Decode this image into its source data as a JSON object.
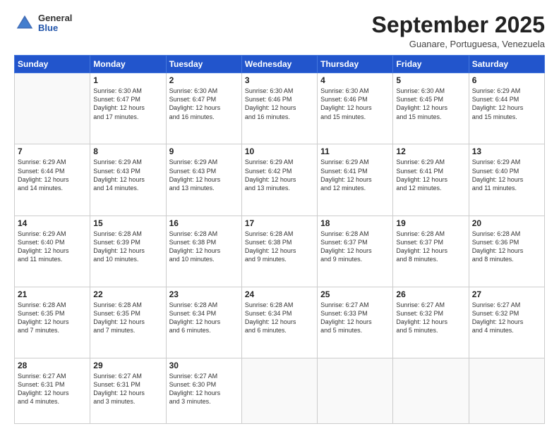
{
  "header": {
    "logo": {
      "line1": "General",
      "line2": "Blue"
    },
    "title": "September 2025",
    "subtitle": "Guanare, Portuguesa, Venezuela"
  },
  "weekdays": [
    "Sunday",
    "Monday",
    "Tuesday",
    "Wednesday",
    "Thursday",
    "Friday",
    "Saturday"
  ],
  "weeks": [
    [
      {
        "day": "",
        "info": ""
      },
      {
        "day": "1",
        "info": "Sunrise: 6:30 AM\nSunset: 6:47 PM\nDaylight: 12 hours\nand 17 minutes."
      },
      {
        "day": "2",
        "info": "Sunrise: 6:30 AM\nSunset: 6:47 PM\nDaylight: 12 hours\nand 16 minutes."
      },
      {
        "day": "3",
        "info": "Sunrise: 6:30 AM\nSunset: 6:46 PM\nDaylight: 12 hours\nand 16 minutes."
      },
      {
        "day": "4",
        "info": "Sunrise: 6:30 AM\nSunset: 6:46 PM\nDaylight: 12 hours\nand 15 minutes."
      },
      {
        "day": "5",
        "info": "Sunrise: 6:30 AM\nSunset: 6:45 PM\nDaylight: 12 hours\nand 15 minutes."
      },
      {
        "day": "6",
        "info": "Sunrise: 6:29 AM\nSunset: 6:44 PM\nDaylight: 12 hours\nand 15 minutes."
      }
    ],
    [
      {
        "day": "7",
        "info": "Sunrise: 6:29 AM\nSunset: 6:44 PM\nDaylight: 12 hours\nand 14 minutes."
      },
      {
        "day": "8",
        "info": "Sunrise: 6:29 AM\nSunset: 6:43 PM\nDaylight: 12 hours\nand 14 minutes."
      },
      {
        "day": "9",
        "info": "Sunrise: 6:29 AM\nSunset: 6:43 PM\nDaylight: 12 hours\nand 13 minutes."
      },
      {
        "day": "10",
        "info": "Sunrise: 6:29 AM\nSunset: 6:42 PM\nDaylight: 12 hours\nand 13 minutes."
      },
      {
        "day": "11",
        "info": "Sunrise: 6:29 AM\nSunset: 6:41 PM\nDaylight: 12 hours\nand 12 minutes."
      },
      {
        "day": "12",
        "info": "Sunrise: 6:29 AM\nSunset: 6:41 PM\nDaylight: 12 hours\nand 12 minutes."
      },
      {
        "day": "13",
        "info": "Sunrise: 6:29 AM\nSunset: 6:40 PM\nDaylight: 12 hours\nand 11 minutes."
      }
    ],
    [
      {
        "day": "14",
        "info": "Sunrise: 6:29 AM\nSunset: 6:40 PM\nDaylight: 12 hours\nand 11 minutes."
      },
      {
        "day": "15",
        "info": "Sunrise: 6:28 AM\nSunset: 6:39 PM\nDaylight: 12 hours\nand 10 minutes."
      },
      {
        "day": "16",
        "info": "Sunrise: 6:28 AM\nSunset: 6:38 PM\nDaylight: 12 hours\nand 10 minutes."
      },
      {
        "day": "17",
        "info": "Sunrise: 6:28 AM\nSunset: 6:38 PM\nDaylight: 12 hours\nand 9 minutes."
      },
      {
        "day": "18",
        "info": "Sunrise: 6:28 AM\nSunset: 6:37 PM\nDaylight: 12 hours\nand 9 minutes."
      },
      {
        "day": "19",
        "info": "Sunrise: 6:28 AM\nSunset: 6:37 PM\nDaylight: 12 hours\nand 8 minutes."
      },
      {
        "day": "20",
        "info": "Sunrise: 6:28 AM\nSunset: 6:36 PM\nDaylight: 12 hours\nand 8 minutes."
      }
    ],
    [
      {
        "day": "21",
        "info": "Sunrise: 6:28 AM\nSunset: 6:35 PM\nDaylight: 12 hours\nand 7 minutes."
      },
      {
        "day": "22",
        "info": "Sunrise: 6:28 AM\nSunset: 6:35 PM\nDaylight: 12 hours\nand 7 minutes."
      },
      {
        "day": "23",
        "info": "Sunrise: 6:28 AM\nSunset: 6:34 PM\nDaylight: 12 hours\nand 6 minutes."
      },
      {
        "day": "24",
        "info": "Sunrise: 6:28 AM\nSunset: 6:34 PM\nDaylight: 12 hours\nand 6 minutes."
      },
      {
        "day": "25",
        "info": "Sunrise: 6:27 AM\nSunset: 6:33 PM\nDaylight: 12 hours\nand 5 minutes."
      },
      {
        "day": "26",
        "info": "Sunrise: 6:27 AM\nSunset: 6:32 PM\nDaylight: 12 hours\nand 5 minutes."
      },
      {
        "day": "27",
        "info": "Sunrise: 6:27 AM\nSunset: 6:32 PM\nDaylight: 12 hours\nand 4 minutes."
      }
    ],
    [
      {
        "day": "28",
        "info": "Sunrise: 6:27 AM\nSunset: 6:31 PM\nDaylight: 12 hours\nand 4 minutes."
      },
      {
        "day": "29",
        "info": "Sunrise: 6:27 AM\nSunset: 6:31 PM\nDaylight: 12 hours\nand 3 minutes."
      },
      {
        "day": "30",
        "info": "Sunrise: 6:27 AM\nSunset: 6:30 PM\nDaylight: 12 hours\nand 3 minutes."
      },
      {
        "day": "",
        "info": ""
      },
      {
        "day": "",
        "info": ""
      },
      {
        "day": "",
        "info": ""
      },
      {
        "day": "",
        "info": ""
      }
    ]
  ]
}
